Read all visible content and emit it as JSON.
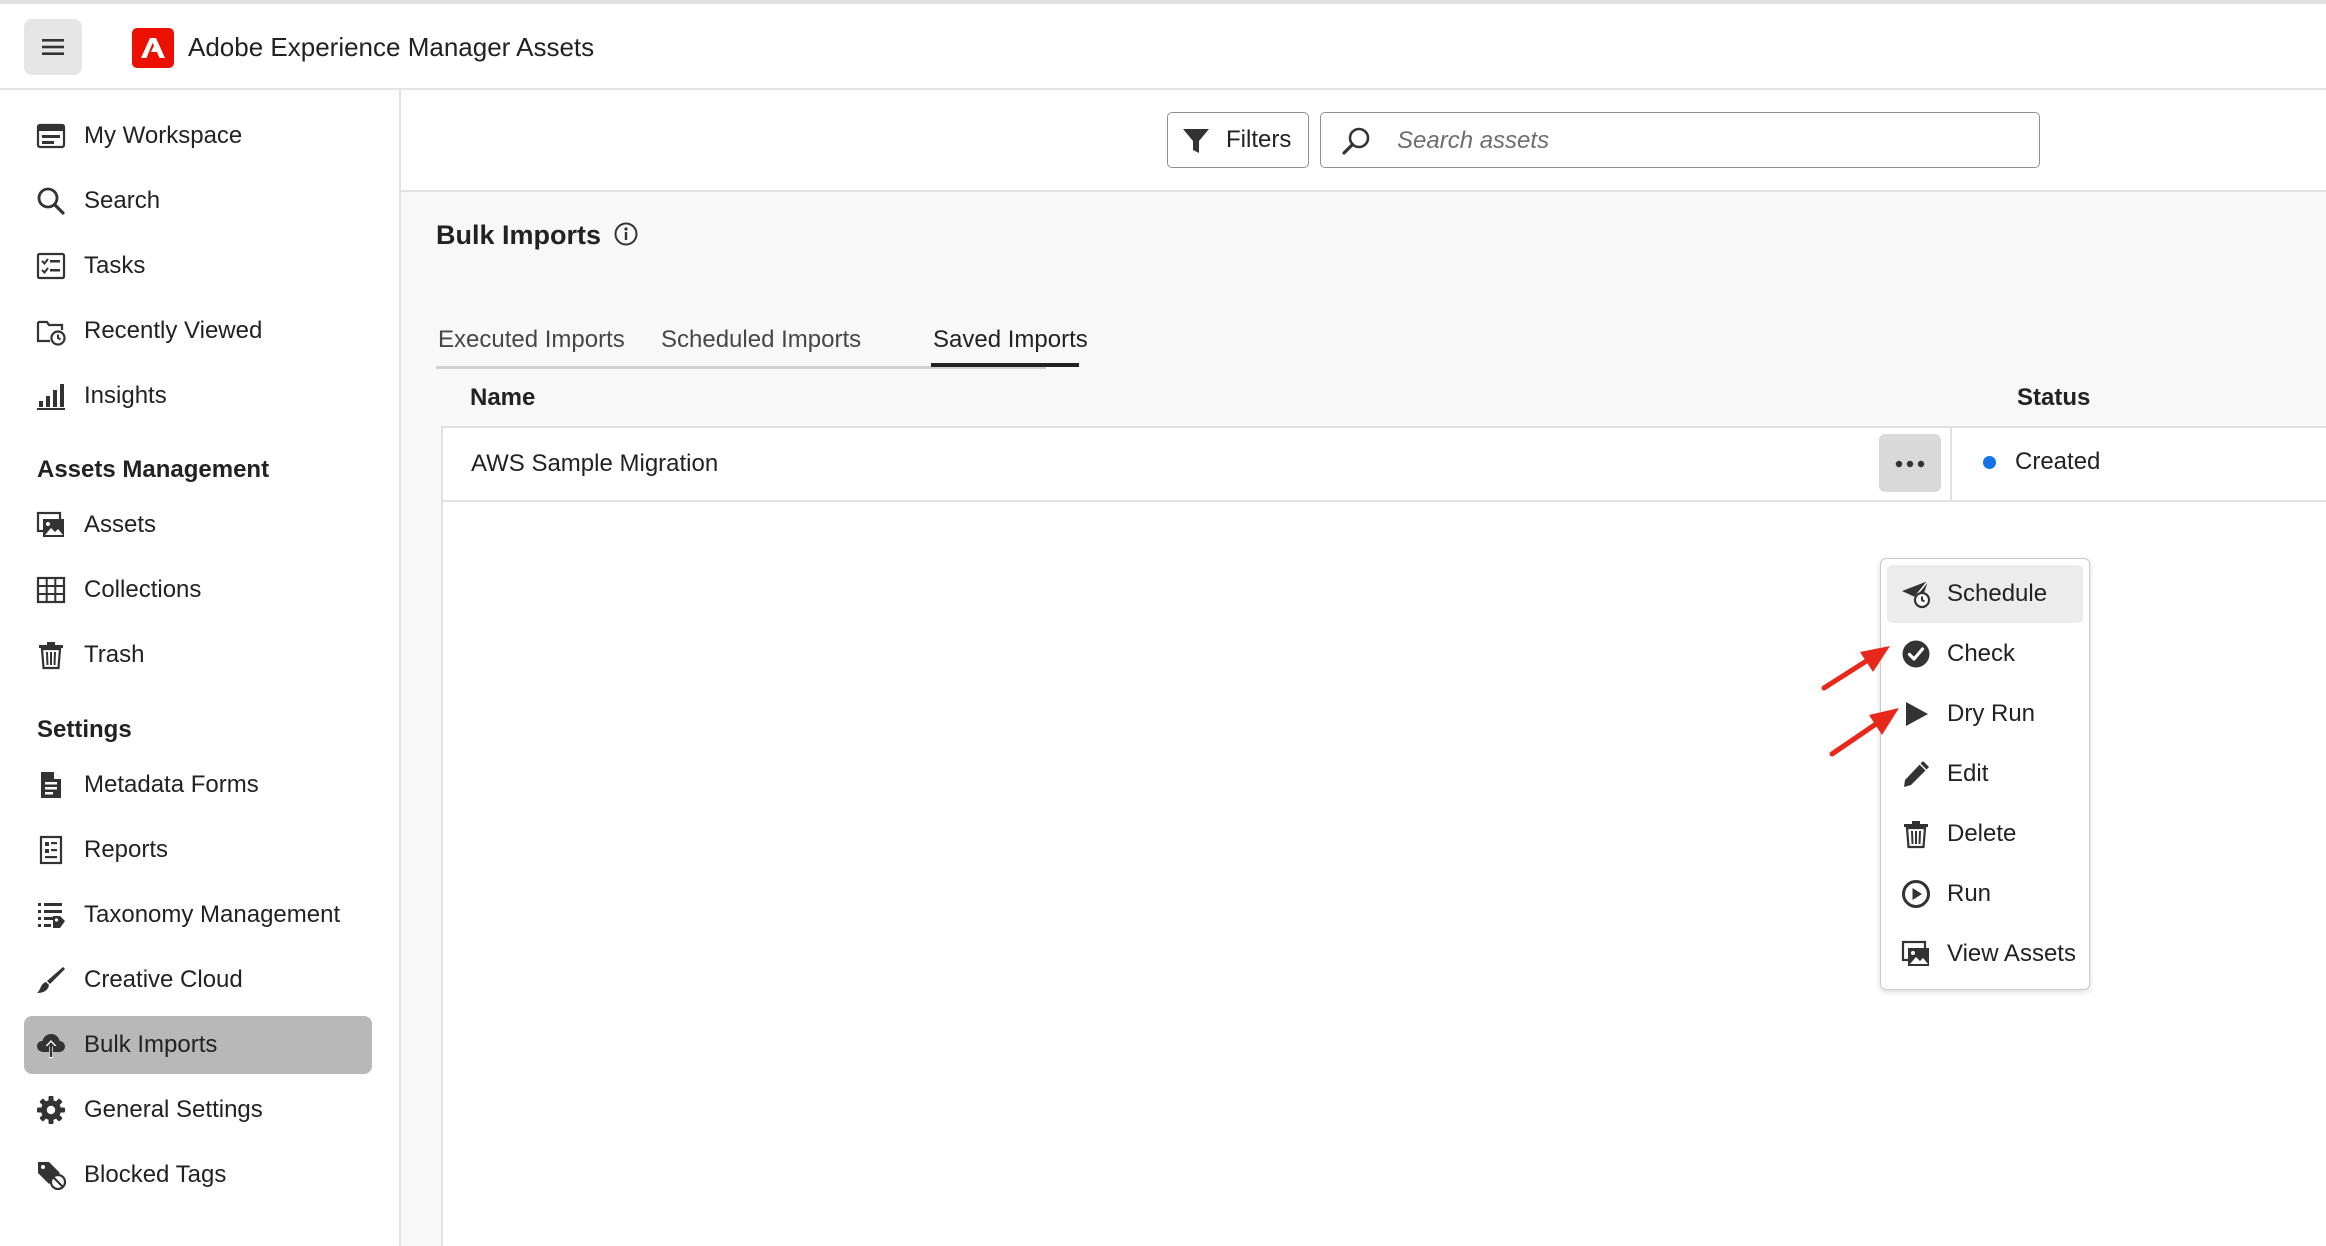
{
  "app": {
    "title": "Adobe Experience Manager Assets"
  },
  "sidebar": {
    "items": [
      {
        "label": "My Workspace",
        "icon": "workspace-icon"
      },
      {
        "label": "Search",
        "icon": "search-icon"
      },
      {
        "label": "Tasks",
        "icon": "tasks-icon"
      },
      {
        "label": "Recently Viewed",
        "icon": "recently-viewed-icon"
      },
      {
        "label": "Insights",
        "icon": "insights-icon"
      }
    ],
    "assets_management_title": "Assets Management",
    "assets_items": [
      {
        "label": "Assets",
        "icon": "assets-icon"
      },
      {
        "label": "Collections",
        "icon": "collections-icon"
      },
      {
        "label": "Trash",
        "icon": "trash-icon"
      }
    ],
    "settings_title": "Settings",
    "settings_items": [
      {
        "label": "Metadata Forms",
        "icon": "metadata-forms-icon"
      },
      {
        "label": "Reports",
        "icon": "reports-icon"
      },
      {
        "label": "Taxonomy Management",
        "icon": "taxonomy-icon"
      },
      {
        "label": "Creative Cloud",
        "icon": "brush-icon"
      },
      {
        "label": "Bulk Imports",
        "icon": "cloud-upload-icon",
        "active": true
      },
      {
        "label": "General Settings",
        "icon": "gear-icon"
      },
      {
        "label": "Blocked Tags",
        "icon": "blocked-tag-icon"
      }
    ]
  },
  "toolbar": {
    "filters_label": "Filters",
    "search_placeholder": "Search assets"
  },
  "page": {
    "title": "Bulk Imports",
    "tabs": [
      {
        "label": "Executed Imports"
      },
      {
        "label": "Scheduled Imports"
      },
      {
        "label": "Saved Imports",
        "selected": true
      }
    ]
  },
  "table": {
    "columns": [
      "Name",
      "Status"
    ],
    "rows": [
      {
        "name": "AWS Sample Migration",
        "status": "Created",
        "status_color": "#1473e6"
      }
    ]
  },
  "context_menu": {
    "items": [
      {
        "label": "Schedule",
        "icon": "schedule-icon"
      },
      {
        "label": "Check",
        "icon": "check-circle-icon"
      },
      {
        "label": "Dry Run",
        "icon": "play-icon"
      },
      {
        "label": "Edit",
        "icon": "pencil-icon"
      },
      {
        "label": "Delete",
        "icon": "trash-icon"
      },
      {
        "label": "Run",
        "icon": "play-circle-icon"
      },
      {
        "label": "View Assets",
        "icon": "view-assets-icon"
      }
    ]
  },
  "colors": {
    "brand": "#eb1000",
    "arrow": "#e8281b",
    "active_nav": "#b8b8b8"
  }
}
